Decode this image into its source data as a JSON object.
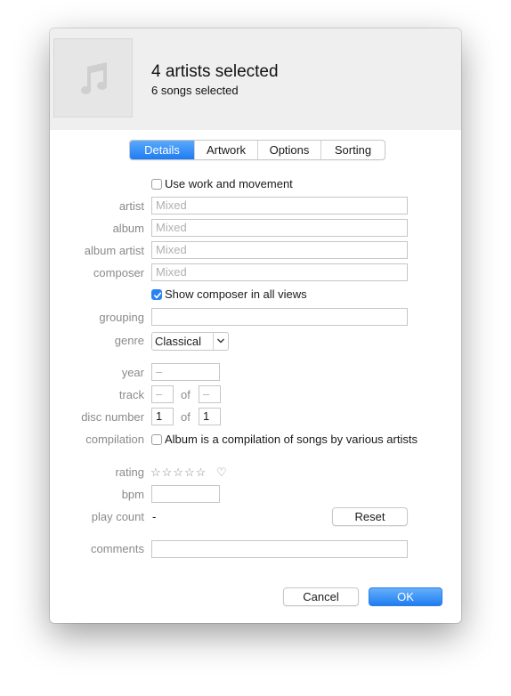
{
  "header": {
    "title": "4 artists selected",
    "subtitle": "6 songs selected",
    "artwork_icon": "music-note-icon"
  },
  "tabs": [
    {
      "label": "Details",
      "active": true
    },
    {
      "label": "Artwork",
      "active": false
    },
    {
      "label": "Options",
      "active": false
    },
    {
      "label": "Sorting",
      "active": false
    }
  ],
  "details": {
    "use_work_movement": {
      "label": "Use work and movement",
      "checked": false
    },
    "artist": {
      "label": "artist",
      "placeholder": "Mixed",
      "value": ""
    },
    "album": {
      "label": "album",
      "placeholder": "Mixed",
      "value": ""
    },
    "album_artist": {
      "label": "album artist",
      "placeholder": "Mixed",
      "value": ""
    },
    "composer": {
      "label": "composer",
      "placeholder": "Mixed",
      "value": ""
    },
    "show_composer": {
      "label": "Show composer in all views",
      "checked": true
    },
    "grouping": {
      "label": "grouping",
      "value": ""
    },
    "genre": {
      "label": "genre",
      "value": "Classical"
    },
    "year": {
      "label": "year",
      "placeholder": "–"
    },
    "track": {
      "label": "track",
      "number_placeholder": "–",
      "of_label": "of",
      "total_placeholder": "–"
    },
    "disc": {
      "label": "disc number",
      "number": "1",
      "of_label": "of",
      "total": "1"
    },
    "compilation": {
      "label": "compilation",
      "text": "Album is a compilation of songs by various artists",
      "checked": false
    },
    "rating": {
      "label": "rating",
      "stars": "☆☆☆☆☆",
      "stars_value": 0,
      "heart": "♡",
      "loved": false
    },
    "bpm": {
      "label": "bpm",
      "value": ""
    },
    "play_count": {
      "label": "play count",
      "value": "-",
      "reset_label": "Reset"
    },
    "comments": {
      "label": "comments",
      "value": ""
    }
  },
  "footer": {
    "cancel_label": "Cancel",
    "ok_label": "OK"
  },
  "colors": {
    "accent": "#1e7cf2",
    "header_bg": "#efefef",
    "label": "#8a8a8a"
  }
}
